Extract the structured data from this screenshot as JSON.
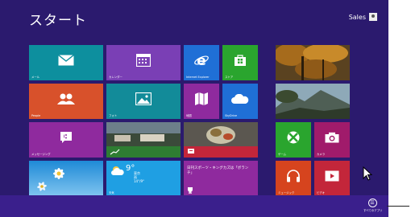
{
  "screen": {
    "title": "スタート",
    "user": "Sales"
  },
  "tiles": {
    "mail": {
      "label": "メール",
      "color": "#0d8f9e"
    },
    "calendar": {
      "label": "カレンダー",
      "color": "#7a3fb5"
    },
    "ie": {
      "label": "Internet Explorer",
      "color": "#1f6fd6"
    },
    "store": {
      "label": "ストア",
      "color": "#2aa52e"
    },
    "people": {
      "label": "People",
      "color": "#d8512b"
    },
    "photos": {
      "label": "フォト",
      "color": "#128b99"
    },
    "maps": {
      "label": "地図",
      "color": "#8f2a9e"
    },
    "skydrive": {
      "label": "SkyDrive",
      "color": "#1f6fd6"
    },
    "messaging": {
      "label": "メッセージング",
      "color": "#8f2a9e"
    },
    "finance": {
      "label": "",
      "color": "#2e7d32"
    },
    "news": {
      "headline": "日刊スポーツ・キングカズは「ボランチ」",
      "color": "#c3263a"
    },
    "desktop": {
      "label": "",
      "color": "#2a6fdb"
    },
    "weather": {
      "temp": "9°",
      "city": "東京",
      "desc": "雨",
      "range": "14°/9°",
      "label": "天気",
      "color": "#1f9fe3"
    },
    "sports": {
      "label": "",
      "color": "#8f2a9e"
    },
    "games": {
      "label": "ゲーム",
      "color": "#2aa52e"
    },
    "camera": {
      "label": "カメラ",
      "color": "#a01b6b"
    },
    "music": {
      "label": "ミュージック",
      "color": "#d6441e"
    },
    "video": {
      "label": "ビデオ",
      "color": "#c3263a"
    }
  },
  "bottom": {
    "all_apps_label": "すべてのアプリ"
  }
}
